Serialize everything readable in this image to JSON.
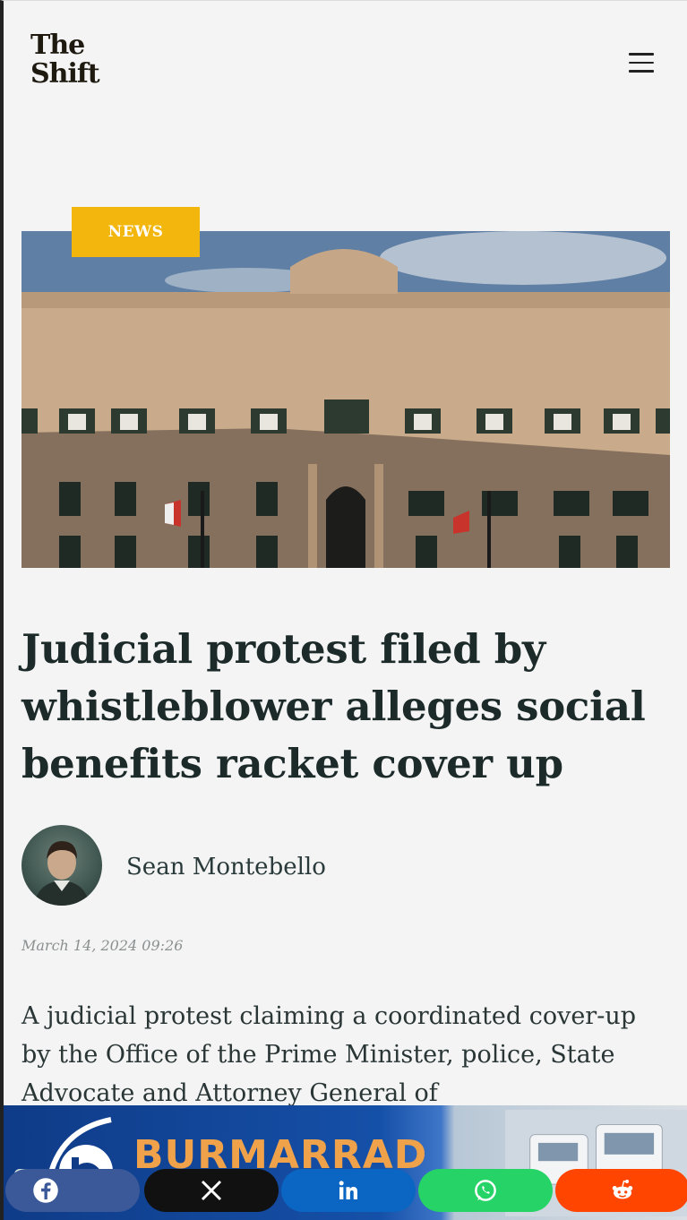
{
  "header": {
    "logo_line1": "The",
    "logo_line2": "Shift",
    "menu_icon": "hamburger-menu-icon"
  },
  "article": {
    "category": "NEWS",
    "title": "Judicial protest filed by whistleblower alleges social benefits racket cover up",
    "author": "Sean Montebello",
    "date": "March 14, 2024 09:26",
    "lede": "A judicial protest claiming a coordinated cover-up by the Office of the Prime Minister, police, State Advocate and Attorney General of"
  },
  "ad": {
    "brand": "BURMARRAD"
  },
  "share": {
    "buttons": [
      {
        "icon": "facebook-icon",
        "color": "#3b5998"
      },
      {
        "icon": "x-icon",
        "color": "#111111"
      },
      {
        "icon": "linkedin-icon",
        "color": "#0a66c2"
      },
      {
        "icon": "whatsapp-icon",
        "color": "#25d366"
      },
      {
        "icon": "reddit-icon",
        "color": "#ff4500"
      }
    ]
  },
  "colors": {
    "accent": "#f3b60c",
    "headline": "#1d2a2a"
  }
}
